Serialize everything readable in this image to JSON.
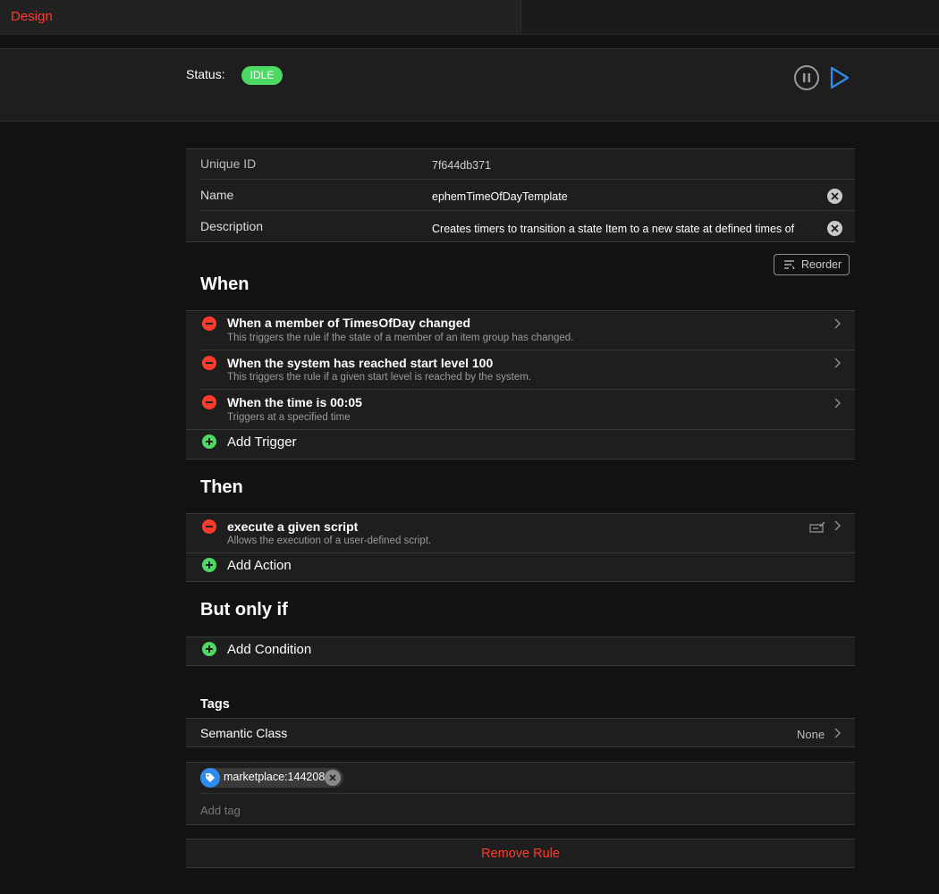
{
  "topbar": {
    "tab_label": "Design"
  },
  "status": {
    "label": "Status:",
    "badge": "IDLE"
  },
  "colors": {
    "accent_red": "#ff3b30",
    "status_green": "#4cd964",
    "play_blue": "#2d8cf0",
    "tag_blue": "#2d8cf0"
  },
  "info": {
    "uid_label": "Unique ID",
    "uid_value": "7f644db371",
    "name_label": "Name",
    "name_value": "ephemTimeOfDayTemplate",
    "desc_label": "Description",
    "desc_value": "Creates timers to transition a state Item to a new state at defined times of"
  },
  "reorder_label": "Reorder",
  "when": {
    "title": "When",
    "items": [
      {
        "title": "When a member of TimesOfDay changed",
        "subtitle": "This triggers the rule if the state of a member of an item group has changed."
      },
      {
        "title": "When the system has reached start level 100",
        "subtitle": "This triggers the rule if a given start level is reached by the system."
      },
      {
        "title": "When the time is 00:05",
        "subtitle": "Triggers at a specified time"
      }
    ],
    "add_label": "Add Trigger"
  },
  "then": {
    "title": "Then",
    "items": [
      {
        "title": "execute a given script",
        "subtitle": "Allows the execution of a user-defined script."
      }
    ],
    "add_label": "Add Action"
  },
  "but_only_if": {
    "title": "But only if",
    "add_label": "Add Condition"
  },
  "tags": {
    "title": "Tags",
    "semantic_label": "Semantic Class",
    "semantic_value": "None",
    "chips": [
      {
        "label": "marketplace:144208"
      }
    ],
    "add_placeholder": "Add tag"
  },
  "remove_label": "Remove Rule"
}
